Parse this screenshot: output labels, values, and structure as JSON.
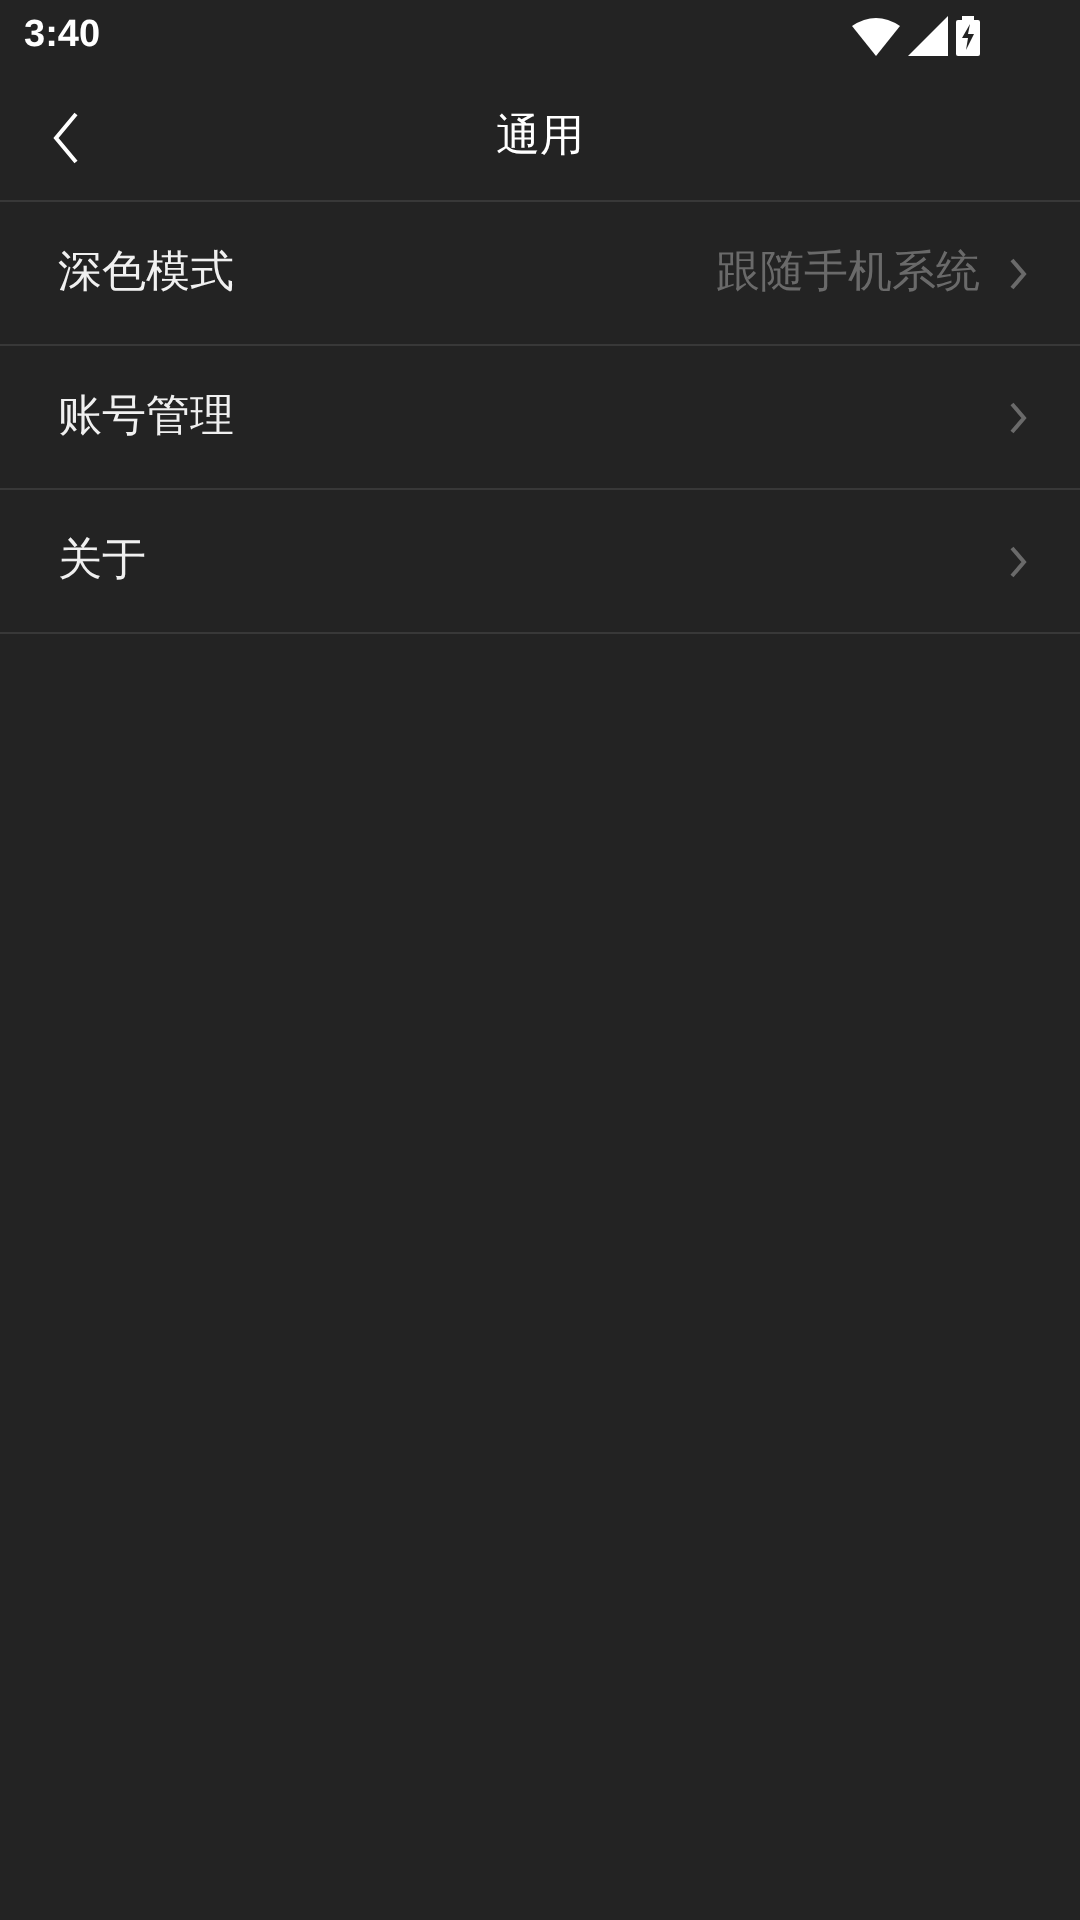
{
  "status_bar": {
    "time": "3:40"
  },
  "header": {
    "title": "通用"
  },
  "items": [
    {
      "label": "深色模式",
      "value": "跟随手机系统"
    },
    {
      "label": "账号管理"
    },
    {
      "label": "关于"
    }
  ]
}
